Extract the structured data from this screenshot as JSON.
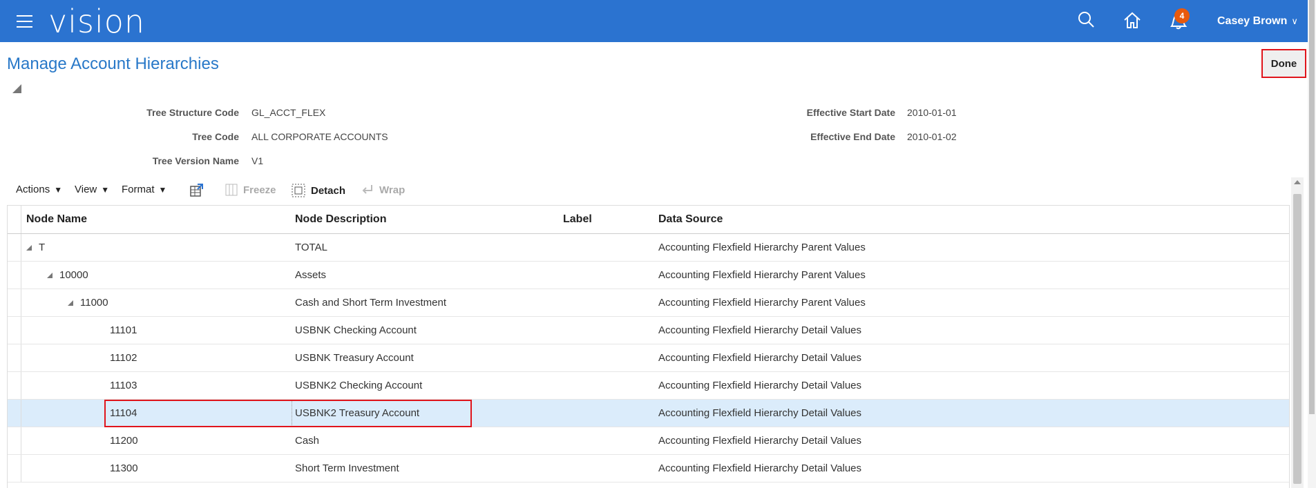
{
  "header": {
    "logo": "vision",
    "notification_count": "4",
    "user_name": "Casey Brown",
    "icons": [
      "menu-icon",
      "search-icon",
      "home-icon",
      "notifications-icon",
      "chevron-down-icon"
    ]
  },
  "page": {
    "title": "Manage Account Hierarchies",
    "done_label": "Done"
  },
  "fields": {
    "tree_structure_code_label": "Tree Structure Code",
    "tree_structure_code": "GL_ACCT_FLEX",
    "tree_code_label": "Tree Code",
    "tree_code": "ALL CORPORATE ACCOUNTS",
    "tree_version_name_label": "Tree Version Name",
    "tree_version_name": "V1",
    "effective_start_date_label": "Effective Start Date",
    "effective_start_date": "2010-01-01",
    "effective_end_date_label": "Effective End Date",
    "effective_end_date": "2010-01-02"
  },
  "toolbar": {
    "actions": "Actions",
    "view": "View",
    "format": "Format",
    "freeze": "Freeze",
    "detach": "Detach",
    "wrap": "Wrap"
  },
  "table": {
    "columns": [
      "Node Name",
      "Node Description",
      "Label",
      "Data Source"
    ],
    "rows": [
      {
        "name": "T",
        "desc": "TOTAL",
        "label": "",
        "source": "Accounting Flexfield Hierarchy Parent Values",
        "level": 0,
        "expandable": true
      },
      {
        "name": "10000",
        "desc": "Assets",
        "label": "",
        "source": "Accounting Flexfield Hierarchy Parent Values",
        "level": 1,
        "expandable": true
      },
      {
        "name": "11000",
        "desc": "Cash and Short Term Investment",
        "label": "",
        "source": "Accounting Flexfield Hierarchy Parent Values",
        "level": 2,
        "expandable": true
      },
      {
        "name": "11101",
        "desc": "USBNK Checking Account",
        "label": "",
        "source": "Accounting Flexfield Hierarchy Detail Values",
        "level": 3,
        "expandable": false
      },
      {
        "name": "11102",
        "desc": "USBNK Treasury Account",
        "label": "",
        "source": "Accounting Flexfield Hierarchy Detail Values",
        "level": 3,
        "expandable": false
      },
      {
        "name": "11103",
        "desc": "USBNK2 Checking Account",
        "label": "",
        "source": "Accounting Flexfield Hierarchy Detail Values",
        "level": 3,
        "expandable": false
      },
      {
        "name": "11104",
        "desc": "USBNK2 Treasury Account",
        "label": "",
        "source": "Accounting Flexfield Hierarchy Detail Values",
        "level": 3,
        "expandable": false,
        "selected": true
      },
      {
        "name": "11200",
        "desc": "Cash",
        "label": "",
        "source": "Accounting Flexfield Hierarchy Detail Values",
        "level": 3,
        "expandable": false
      },
      {
        "name": "11300",
        "desc": "Short Term Investment",
        "label": "",
        "source": "Accounting Flexfield Hierarchy Detail Values",
        "level": 3,
        "expandable": false
      }
    ]
  }
}
